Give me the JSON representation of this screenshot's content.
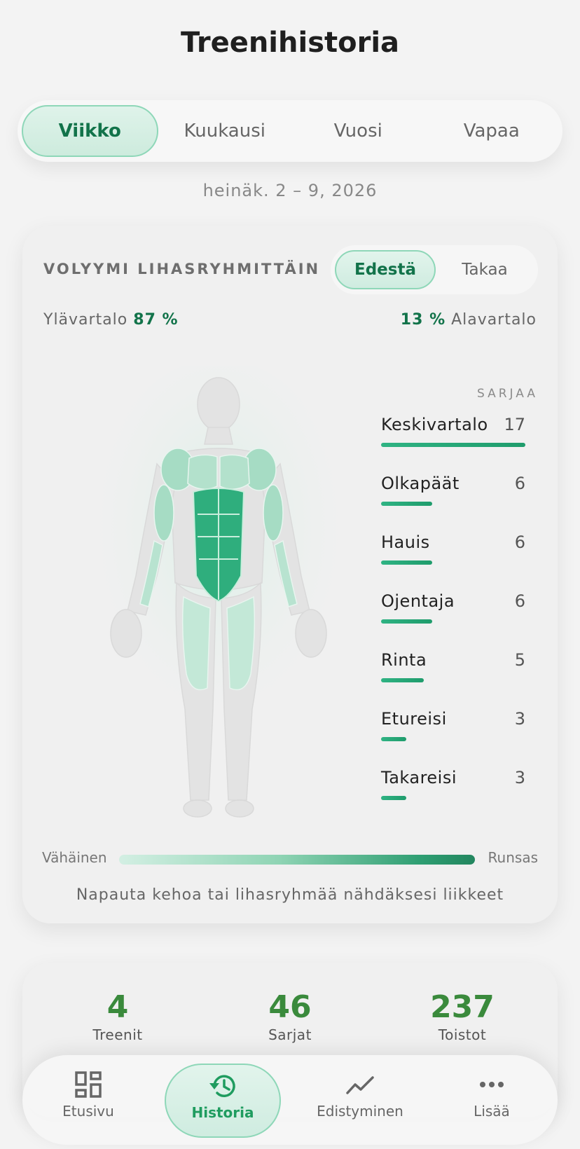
{
  "header": {
    "title": "Treenihistoria"
  },
  "period_tabs": [
    {
      "label": "Viikko",
      "active": true
    },
    {
      "label": "Kuukausi",
      "active": false
    },
    {
      "label": "Vuosi",
      "active": false
    },
    {
      "label": "Vapaa",
      "active": false
    }
  ],
  "date_range": "heinäk. 2 – 9, 2026",
  "volume_card": {
    "title": "VOLYYMI LIHASRYHMITTÄIN",
    "view_options": [
      {
        "label": "Edestä",
        "active": true
      },
      {
        "label": "Takaa",
        "active": false
      }
    ],
    "upper_label": "Ylävartalo",
    "upper_percent": "87 %",
    "lower_percent": "13 %",
    "lower_label": "Alavartalo",
    "sets_header": "SARJAA",
    "muscle_groups": [
      {
        "name": "Keskivartalo",
        "sets": "17"
      },
      {
        "name": "Olkapäät",
        "sets": "6"
      },
      {
        "name": "Hauis",
        "sets": "6"
      },
      {
        "name": "Ojentaja",
        "sets": "6"
      },
      {
        "name": "Rinta",
        "sets": "5"
      },
      {
        "name": "Etureisi",
        "sets": "3"
      },
      {
        "name": "Takareisi",
        "sets": "3"
      }
    ],
    "legend_low": "Vähäinen",
    "legend_high": "Runsas",
    "hint": "Napauta kehoa tai lihasryhmää nähdäksesi liikkeet",
    "colors": {
      "accent": "#1f9c6c",
      "active_text": "#12734a",
      "muscle_light": "#a6dcc4",
      "muscle_strong": "#2fae7d"
    }
  },
  "summary_stats": [
    {
      "value": "4",
      "label": "Treenit"
    },
    {
      "value": "46",
      "label": "Sarjat"
    },
    {
      "value": "237",
      "label": "Toistot"
    }
  ],
  "bottom_nav": [
    {
      "label": "Etusivu",
      "icon": "dashboard-grid-icon",
      "active": false
    },
    {
      "label": "Historia",
      "icon": "history-clock-icon",
      "active": true
    },
    {
      "label": "Edistyminen",
      "icon": "trend-line-icon",
      "active": false
    },
    {
      "label": "Lisää",
      "icon": "more-dots-icon",
      "active": false
    }
  ]
}
